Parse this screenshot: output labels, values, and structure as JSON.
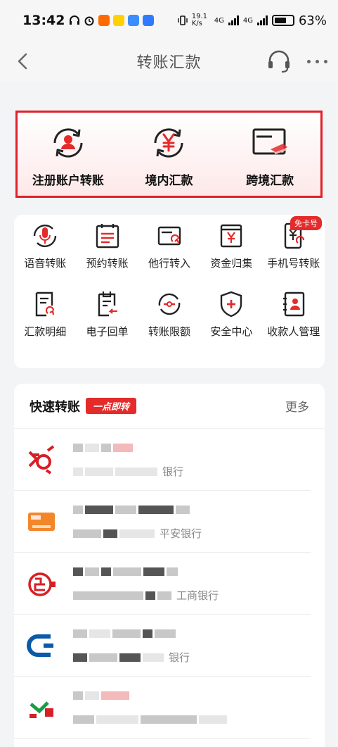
{
  "status_bar": {
    "time": "13:42",
    "net_speed": "19.1 K/s",
    "network_1": "4G",
    "network_2": "4G",
    "battery": "63%"
  },
  "nav": {
    "title": "转账汇款"
  },
  "transfer_options": [
    {
      "label": "注册账户转账",
      "icon": "account-transfer-icon"
    },
    {
      "label": "境内汇款",
      "icon": "yuan-exchange-icon"
    },
    {
      "label": "跨境汇款",
      "icon": "cross-border-card-icon"
    }
  ],
  "functions": [
    {
      "label": "语音转账",
      "icon": "microphone-icon"
    },
    {
      "label": "预约转账",
      "icon": "calendar-icon"
    },
    {
      "label": "他行转入",
      "icon": "bank-card-in-icon"
    },
    {
      "label": "资金归集",
      "icon": "fund-collect-icon"
    },
    {
      "label": "手机号转账",
      "icon": "phone-yuan-icon",
      "badge": "免卡号"
    },
    {
      "label": "汇款明细",
      "icon": "detail-doc-icon"
    },
    {
      "label": "电子回单",
      "icon": "receipt-icon"
    },
    {
      "label": "转账限额",
      "icon": "limit-icon"
    },
    {
      "label": "安全中心",
      "icon": "shield-icon"
    },
    {
      "label": "收款人管理",
      "icon": "payee-book-icon"
    }
  ],
  "quick_transfer": {
    "title": "快速转账",
    "tag": "一点即转",
    "more": "更多",
    "payees": [
      {
        "bank_text": "银行",
        "logo": "red-bank-logo"
      },
      {
        "bank_text": "平安银行",
        "logo": "pingan-card-logo"
      },
      {
        "bank_text": "工商银行",
        "logo": "icbc-logo"
      },
      {
        "bank_text": "银行",
        "logo": "blue-bank-logo"
      },
      {
        "bank_text": "",
        "logo": "green-bank-logo"
      }
    ]
  },
  "colors": {
    "accent": "#e52a2a",
    "highlight_border": "#e0202a"
  }
}
